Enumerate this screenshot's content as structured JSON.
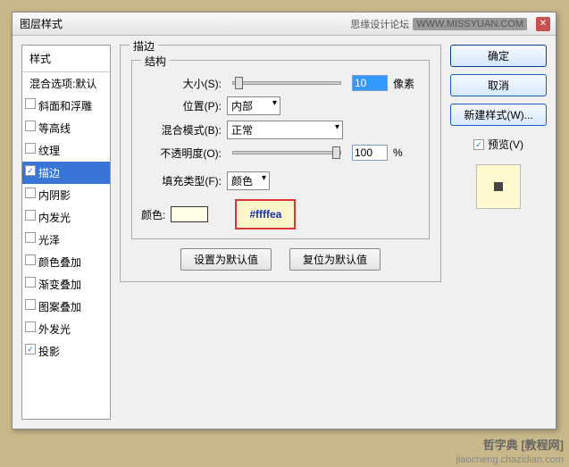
{
  "titlebar": {
    "title": "图层样式",
    "site": "思缘设计论坛",
    "url": "WWW.MISSYUAN.COM"
  },
  "sidebar": {
    "header": "样式",
    "default_item": "混合选项:默认",
    "items": [
      {
        "label": "斜面和浮雕",
        "checked": false
      },
      {
        "label": "等高线",
        "checked": false
      },
      {
        "label": "纹理",
        "checked": false
      },
      {
        "label": "描边",
        "checked": true,
        "selected": true
      },
      {
        "label": "内阴影",
        "checked": false
      },
      {
        "label": "内发光",
        "checked": false
      },
      {
        "label": "光泽",
        "checked": false
      },
      {
        "label": "颜色叠加",
        "checked": false
      },
      {
        "label": "渐变叠加",
        "checked": false
      },
      {
        "label": "图案叠加",
        "checked": false
      },
      {
        "label": "外发光",
        "checked": false
      },
      {
        "label": "投影",
        "checked": true
      }
    ]
  },
  "panel": {
    "title": "描边",
    "structure": "结构",
    "size_label": "大小(S):",
    "size_value": "10",
    "size_unit": "像素",
    "position_label": "位置(P):",
    "position_value": "内部",
    "blend_label": "混合模式(B):",
    "blend_value": "正常",
    "opacity_label": "不透明度(O):",
    "opacity_value": "100",
    "opacity_unit": "%",
    "filltype_label": "填充类型(F):",
    "filltype_value": "颜色",
    "color_label": "颜色:",
    "callout": "#ffffea",
    "btn_default": "设置为默认值",
    "btn_reset": "复位为默认值"
  },
  "right": {
    "ok": "确定",
    "cancel": "取消",
    "newstyle": "新建样式(W)...",
    "preview": "预览(V)"
  },
  "watermark1": "哲字典 [教程网]",
  "watermark2": "jiaocheng.chazidian.com"
}
